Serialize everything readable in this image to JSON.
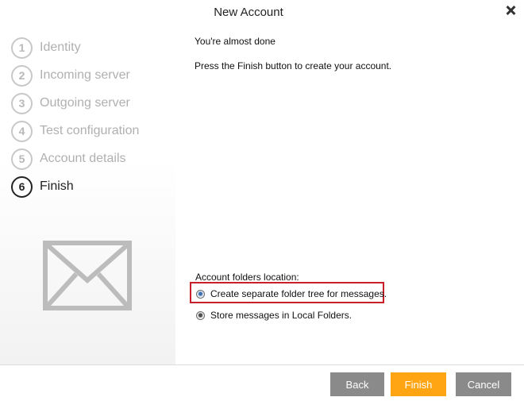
{
  "window": {
    "title": "New Account"
  },
  "steps": [
    {
      "number": "1",
      "label": "Identity"
    },
    {
      "number": "2",
      "label": "Incoming server"
    },
    {
      "number": "3",
      "label": "Outgoing server"
    },
    {
      "number": "4",
      "label": "Test configuration"
    },
    {
      "number": "5",
      "label": "Account details"
    },
    {
      "number": "6",
      "label": "Finish"
    }
  ],
  "active_step": "6",
  "main": {
    "heading": "You're almost done",
    "instruction": "Press the Finish button to create your account.",
    "folders_label": "Account folders location:",
    "options": [
      {
        "label": "Create separate folder tree for messages.",
        "selected": true
      },
      {
        "label": "Store messages in Local Folders.",
        "selected": false
      }
    ]
  },
  "buttons": {
    "back": "Back",
    "finish": "Finish",
    "cancel": "Cancel"
  },
  "colors": {
    "accent": "#ffa412",
    "button_gray": "#8a8a8a",
    "highlight": "#c8202a"
  }
}
